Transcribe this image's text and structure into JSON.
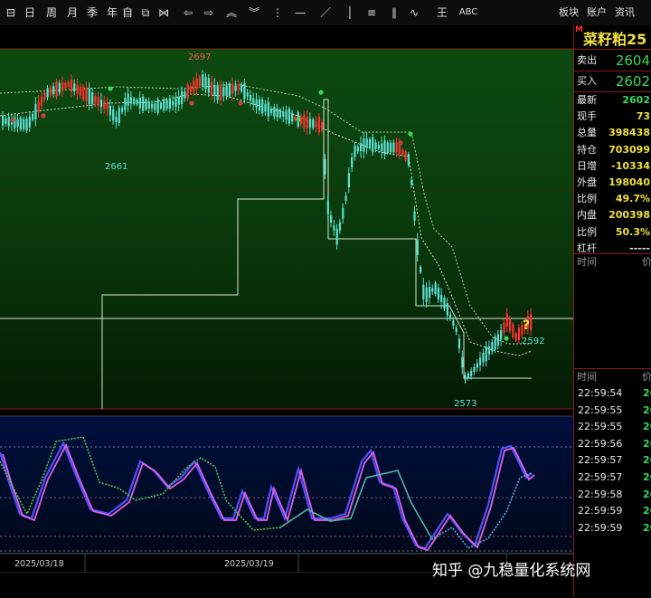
{
  "toolbar": {
    "left_items": [
      {
        "name": "bars-icon",
        "glyph": "⊟"
      },
      {
        "name": "daily-period",
        "label": "日"
      },
      {
        "name": "weekly-period",
        "label": "周"
      },
      {
        "name": "monthly-period",
        "label": "月"
      },
      {
        "name": "quarterly-period",
        "label": "季"
      },
      {
        "name": "yearly-period",
        "label": "年"
      },
      {
        "name": "custom-period",
        "label": "自"
      },
      {
        "name": "expand-icon",
        "glyph": "⧉"
      },
      {
        "name": "shrink-icon",
        "glyph": "⋈"
      },
      {
        "name": "arrow-left-icon",
        "glyph": "⇦"
      },
      {
        "name": "arrow-right-icon",
        "glyph": "⇨"
      },
      {
        "name": "zoom-in-icon",
        "glyph": "︽"
      },
      {
        "name": "zoom-out-icon",
        "glyph": "︾"
      },
      {
        "name": "cursor-icon",
        "glyph": "⋮"
      },
      {
        "name": "horizontal-line-icon",
        "glyph": "—"
      },
      {
        "name": "ray-icon",
        "glyph": "／"
      },
      {
        "name": "vertical-line-icon",
        "glyph": "│"
      },
      {
        "name": "channel-icon",
        "glyph": "≡"
      },
      {
        "name": "parallel-lines-icon",
        "glyph": "∥"
      },
      {
        "name": "wave-icon",
        "glyph": "∿"
      },
      {
        "name": "fib-icon",
        "glyph": "王"
      },
      {
        "name": "text-tool",
        "label": "ABC"
      },
      {
        "name": "more-icon",
        "glyph": "⋯"
      }
    ],
    "right_items": [
      {
        "name": "sector-button",
        "label": "板块"
      },
      {
        "name": "account-button",
        "label": "账户"
      },
      {
        "name": "news-button",
        "label": "资讯"
      }
    ]
  },
  "side_panel": {
    "badge": "M",
    "title": "菜籽粕25",
    "ask": {
      "label": "卖出",
      "value": "2604"
    },
    "bid": {
      "label": "买入",
      "value": "2602"
    },
    "stats": [
      {
        "label": "最新",
        "value": "2602",
        "color": "#3dd65b"
      },
      {
        "label": "现手",
        "value": "73",
        "color": "#f0e040"
      },
      {
        "label": "总量",
        "value": "398438",
        "color": "#f0e040"
      },
      {
        "label": "持仓",
        "value": "703099",
        "color": "#f0e040"
      },
      {
        "label": "日增",
        "value": "-10334",
        "color": "#f0e040"
      },
      {
        "label": "外盘",
        "value": "198040",
        "color": "#f0e040"
      },
      {
        "label": "比例",
        "value": "49.7%",
        "color": "#f0e040"
      },
      {
        "label": "内盘",
        "value": "200398",
        "color": "#f0e040"
      },
      {
        "label": "比例",
        "value": "50.3%",
        "color": "#f0e040"
      },
      {
        "label": "杠杆",
        "value": "-----",
        "color": "#e8e8e8"
      }
    ],
    "header1": {
      "time": "时间",
      "price": "价"
    },
    "header2": {
      "time": "时间",
      "price": "价"
    },
    "ticks": [
      {
        "time": "22:59:54",
        "price": "26"
      },
      {
        "time": "22:59:55",
        "price": "26"
      },
      {
        "time": "22:59:55",
        "price": "26"
      },
      {
        "time": "22:59:56",
        "price": "26"
      },
      {
        "time": "22:59:57",
        "price": "26"
      },
      {
        "time": "22:59:57",
        "price": "26"
      },
      {
        "time": "22:59:58",
        "price": "26"
      },
      {
        "time": "22:59:59",
        "price": "26"
      },
      {
        "time": "22:59:59",
        "price": "26"
      }
    ]
  },
  "main_chart": {
    "price_labels": [
      {
        "text": "2697",
        "color": "#ff5555"
      },
      {
        "text": "2661",
        "color": "#5ee0d4"
      },
      {
        "text": "2592",
        "color": "#5ee0d4"
      },
      {
        "text": "2573",
        "color": "#5ee0d4"
      }
    ],
    "question_mark": "?",
    "dates": [
      "2025/03/18",
      "2025/03/19"
    ]
  },
  "watermark": "知乎 @九稳量化系统网",
  "colors": {
    "bull": "#ff3030",
    "bear": "#5ee0d4",
    "signal": "#f0e040"
  }
}
